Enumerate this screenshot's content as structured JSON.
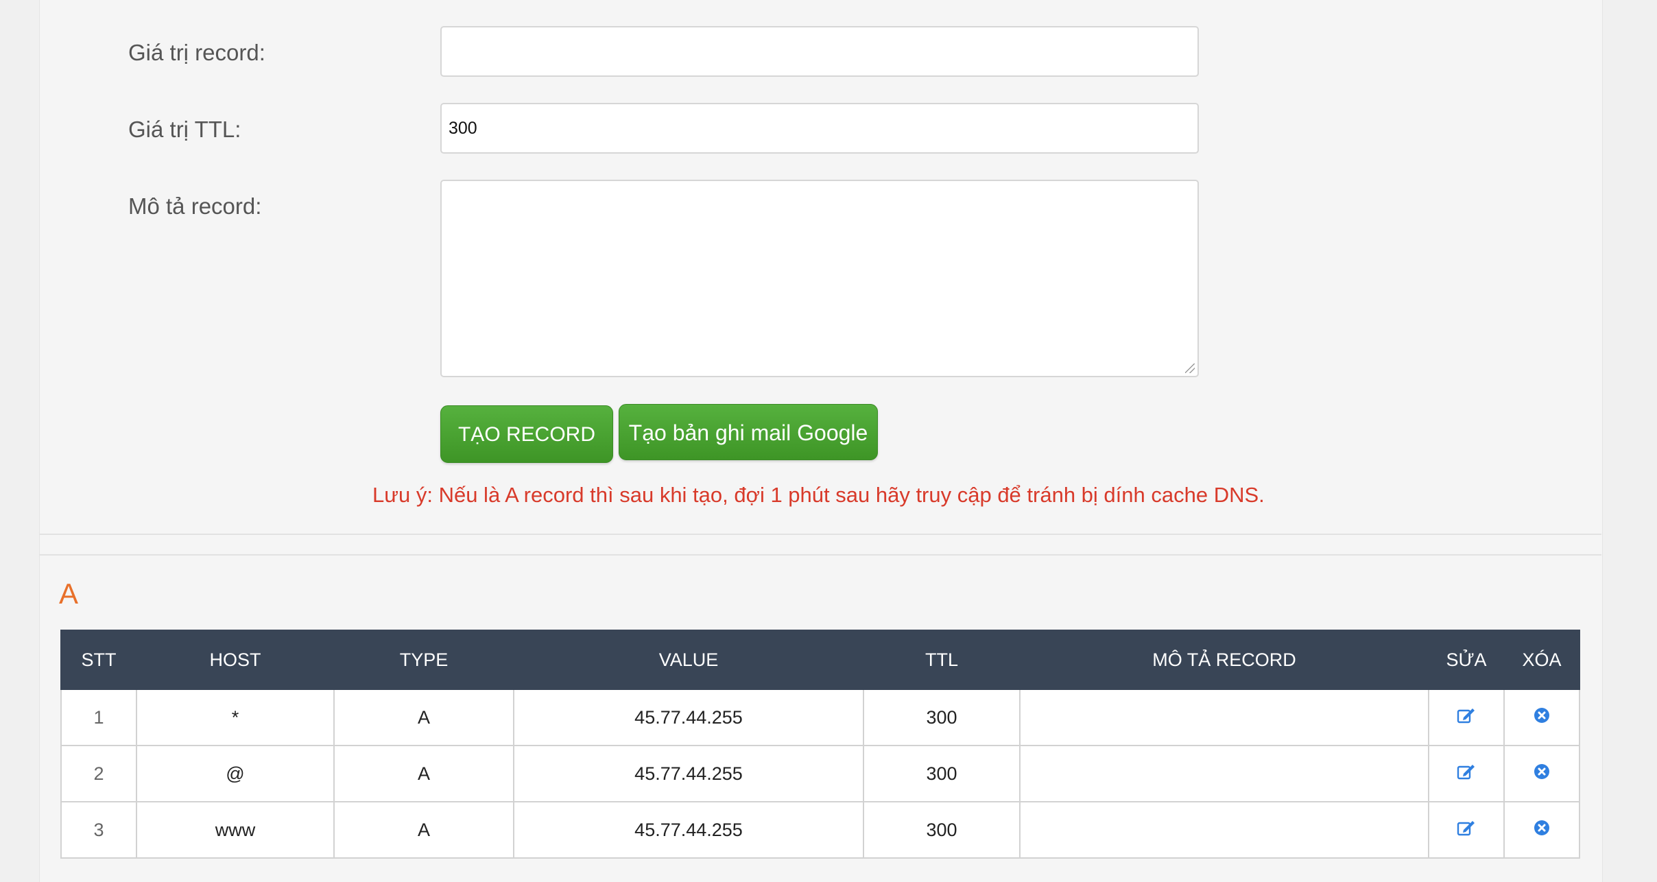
{
  "form": {
    "record_value_label": "Giá trị record:",
    "record_value": "",
    "ttl_label": "Giá trị TTL:",
    "ttl_value": "300",
    "description_label": "Mô tả record:",
    "description_value": "",
    "create_button": "TẠO RECORD",
    "google_mail_button": "Tạo bản ghi mail Google",
    "note": "Lưu ý: Nếu là A record thì sau khi tạo, đợi 1 phút sau hãy truy cập để tránh bị dính cache DNS."
  },
  "section": {
    "title": "A"
  },
  "table": {
    "headers": [
      "STT",
      "HOST",
      "TYPE",
      "VALUE",
      "TTL",
      "MÔ TẢ RECORD",
      "SỬA",
      "XÓA"
    ],
    "rows": [
      {
        "stt": "1",
        "host": "*",
        "type": "A",
        "value": "45.77.44.255",
        "ttl": "300",
        "desc": ""
      },
      {
        "stt": "2",
        "host": "@",
        "type": "A",
        "value": "45.77.44.255",
        "ttl": "300",
        "desc": ""
      },
      {
        "stt": "3",
        "host": "www",
        "type": "A",
        "value": "45.77.44.255",
        "ttl": "300",
        "desc": ""
      }
    ]
  },
  "icons": {
    "edit": "edit-icon",
    "delete": "delete-icon"
  },
  "colors": {
    "button_green": "#4caa33",
    "note_red": "#d83a2a",
    "section_orange": "#e8702a",
    "table_header": "#394556",
    "icon_blue": "#2f7fe0"
  }
}
